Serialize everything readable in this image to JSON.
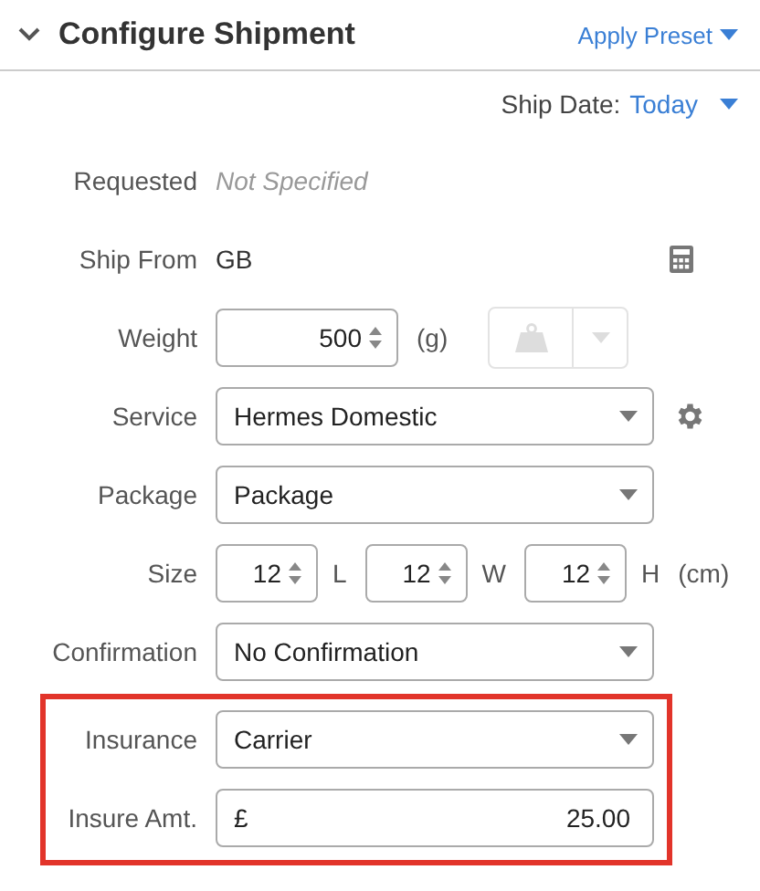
{
  "header": {
    "title": "Configure Shipment",
    "expanded": true,
    "preset_button": "Apply Preset"
  },
  "ship_date": {
    "label": "Ship Date:",
    "value": "Today"
  },
  "rows": [
    {
      "kind": "text",
      "label": "Requested",
      "value": "Not Specified",
      "highlighted": false
    },
    {
      "kind": "readonly",
      "label": "Ship From",
      "value": "GB",
      "highlighted": false
    },
    {
      "kind": "weight",
      "label": "Weight",
      "value": "500",
      "unit": "(g)",
      "highlighted": false
    },
    {
      "kind": "select",
      "label": "Service",
      "value": "Hermes Domestic",
      "settings": true,
      "highlighted": false
    },
    {
      "kind": "select",
      "label": "Package",
      "value": "Package",
      "settings": false,
      "highlighted": false
    },
    {
      "kind": "size",
      "label": "Size",
      "dims": [
        {
          "value": "12",
          "label": "L"
        },
        {
          "value": "12",
          "label": "W"
        },
        {
          "value": "12",
          "label": "H"
        }
      ],
      "unit": "(cm)",
      "highlighted": false
    },
    {
      "kind": "select",
      "label": "Confirmation",
      "value": "No Confirmation",
      "settings": false,
      "highlighted": false
    },
    {
      "kind": "select",
      "label": "Insurance",
      "value": "Carrier",
      "settings": false,
      "highlighted": true
    },
    {
      "kind": "currency",
      "label": "Insure Amt.",
      "symbol": "£",
      "value": "25.00",
      "highlighted": true
    }
  ]
}
